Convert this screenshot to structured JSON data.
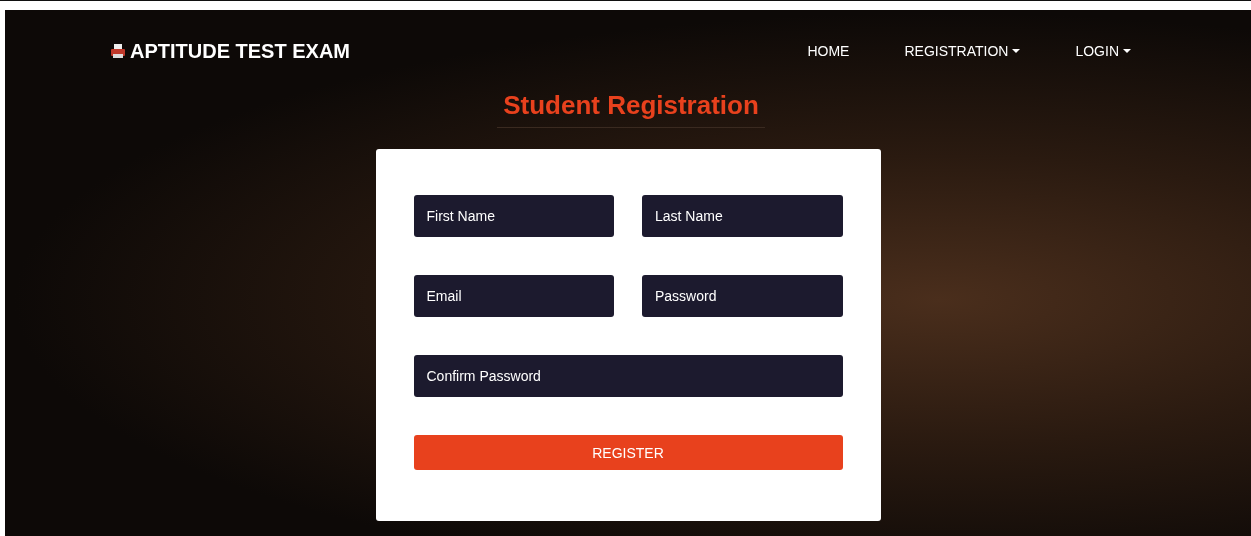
{
  "brand": {
    "title": "APTITUDE TEST EXAM"
  },
  "nav": [
    {
      "label": "HOME",
      "kind": "link"
    },
    {
      "label": "REGISTRATION",
      "kind": "dropdown"
    },
    {
      "label": "LOGIN",
      "kind": "dropdown"
    }
  ],
  "heading": "Student Registration",
  "form": {
    "rows": [
      [
        {
          "placeholder": "First Name"
        },
        {
          "placeholder": "Last Name"
        }
      ],
      [
        {
          "placeholder": "Email"
        },
        {
          "placeholder": "Password"
        }
      ],
      [
        {
          "placeholder": "Confirm Password"
        }
      ]
    ],
    "submit": "REGISTER"
  }
}
